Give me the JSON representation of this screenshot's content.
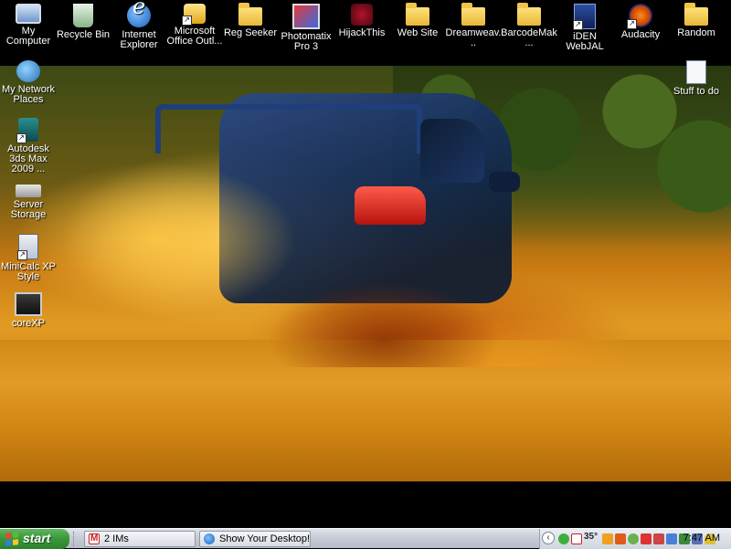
{
  "desktop": {
    "icons_top": [
      {
        "label": "My Computer",
        "icon": "computer-icon"
      },
      {
        "label": "Recycle Bin",
        "icon": "recycle-bin-icon"
      },
      {
        "label": "Internet Explorer",
        "icon": "internet-explorer-icon"
      },
      {
        "label": "Microsoft Office Outl...",
        "icon": "outlook-icon"
      },
      {
        "label": "Reg Seeker",
        "icon": "folder-icon"
      },
      {
        "label": "Photomatix Pro 3",
        "icon": "photomatix-icon"
      },
      {
        "label": "HijackThis",
        "icon": "hijackthis-icon"
      },
      {
        "label": "Web Site",
        "icon": "folder-icon"
      },
      {
        "label": "Dreamweav...",
        "icon": "folder-icon"
      },
      {
        "label": "BarcodeMak...",
        "icon": "folder-icon"
      },
      {
        "label": "iDEN WebJAL",
        "icon": "iden-icon"
      },
      {
        "label": "Audacity",
        "icon": "audacity-icon"
      },
      {
        "label": "Random",
        "icon": "folder-icon"
      }
    ],
    "icons_left": [
      {
        "label": "My Network Places",
        "icon": "network-icon"
      },
      {
        "label": "Autodesk 3ds Max 2009 ...",
        "icon": "autodesk-icon"
      },
      {
        "label": "Server Storage",
        "icon": "storage-icon"
      },
      {
        "label": "MiniCalc XP Style",
        "icon": "calculator-icon"
      },
      {
        "label": "coreXP",
        "icon": "corexp-icon"
      }
    ],
    "icons_right": [
      {
        "label": "Stuff to do",
        "icon": "document-icon"
      }
    ]
  },
  "taskbar": {
    "start_label": "start",
    "tasks": [
      {
        "label": "2 IMs",
        "icon": "gmail-icon"
      },
      {
        "label": "Show Your Desktop! -...",
        "icon": "internet-explorer-icon"
      }
    ],
    "tray": {
      "temperature": "35°",
      "clock": "7:47 AM"
    }
  },
  "colors": {
    "start_green": "#3a9a3a",
    "taskbar_silver": "#c7ccd6"
  }
}
